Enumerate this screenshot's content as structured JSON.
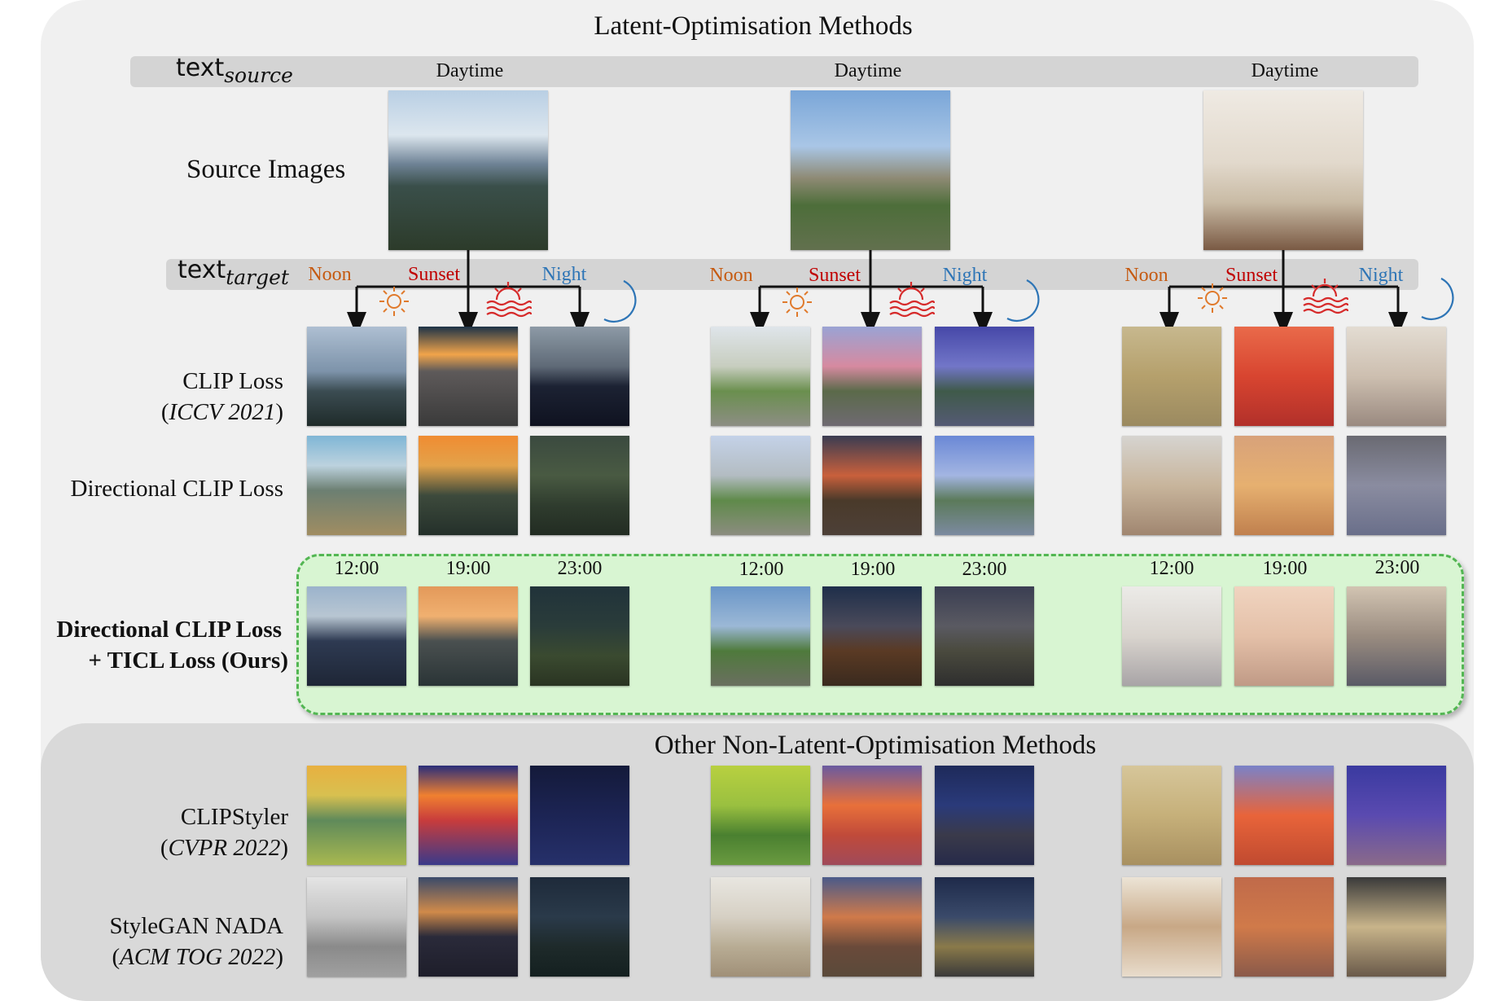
{
  "title_latent": "Latent-Optimisation Methods",
  "title_other": "Other Non-Latent-Optimisation Methods",
  "text_source": {
    "base": "text",
    "sub": "source"
  },
  "text_target": {
    "base": "text",
    "sub": "target"
  },
  "source_caption": "Daytime",
  "source_row_label": "Source Images",
  "conditions": {
    "noon": "Noon",
    "sunset": "Sunset",
    "night": "Night"
  },
  "condition_colors": {
    "noon": "#c55a11",
    "sunset": "#c00000",
    "night": "#2e75b6"
  },
  "times": [
    "12:00",
    "19:00",
    "23:00"
  ],
  "rows": {
    "clip": {
      "name": "CLIP Loss",
      "venue": "ICCV 2021"
    },
    "dirclip": {
      "name": "Directional CLIP Loss"
    },
    "ours": {
      "line1": "Directional CLIP Loss",
      "line2": "+ TICL Loss (Ours)"
    },
    "clipstyler": {
      "name": "CLIPStyler",
      "venue": "CVPR 2022"
    },
    "nada": {
      "name": "StyleGAN NADA",
      "venue": "ACM TOG 2022"
    }
  },
  "accent_colors": {
    "ours_box_fill": "#d8f5d2",
    "ours_box_border": "#53b653"
  }
}
